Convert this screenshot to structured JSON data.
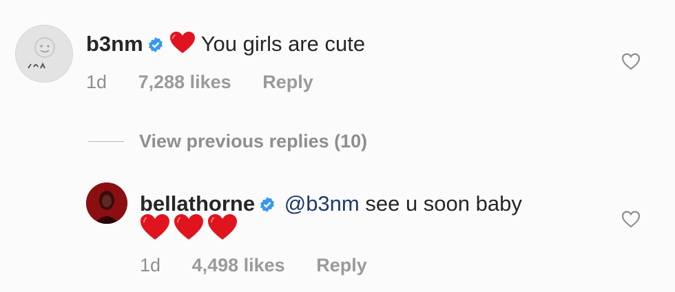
{
  "comment": {
    "username": "b3nm",
    "text": "You girls are cute",
    "time": "1d",
    "likes": "7,288 likes",
    "reply": "Reply"
  },
  "view_replies": {
    "label": "View previous replies (10)"
  },
  "reply_comment": {
    "username": "bellathorne",
    "mention": "@b3nm",
    "text": "see u soon baby",
    "emoji_count": 3,
    "time": "1d",
    "likes": "4,498 likes",
    "reply": "Reply"
  },
  "colors": {
    "verified_badge": "#3897f0",
    "heart_emoji": "#e0141e",
    "mention": "#1d3a6b",
    "meta_text": "#8e8e8e"
  },
  "icons": [
    "verified-badge-icon",
    "red-heart-emoji-icon",
    "heart-outline-icon"
  ]
}
